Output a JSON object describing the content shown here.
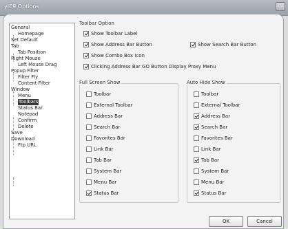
{
  "window": {
    "title": "yIE9 Options"
  },
  "tree": {
    "items": [
      {
        "label": "General"
      },
      {
        "label": "Homepage"
      },
      {
        "label": "Set Default"
      },
      {
        "label": "Tab"
      },
      {
        "label": "Tab Position"
      },
      {
        "label": "Right Mouse"
      },
      {
        "label": "Left Mouse Drag"
      },
      {
        "label": "Popup Filter"
      },
      {
        "label": "Filter Fly"
      },
      {
        "label": "Content Filter"
      },
      {
        "label": "Window"
      },
      {
        "label": "Menu"
      },
      {
        "label": "Toolbars"
      },
      {
        "label": "Status Bar"
      },
      {
        "label": "Notepad"
      },
      {
        "label": "Confirm"
      },
      {
        "label": "Delete"
      },
      {
        "label": "Save"
      },
      {
        "label": "Download"
      },
      {
        "label": "Ftp URL"
      }
    ],
    "selected": "Toolbars"
  },
  "toolbar_option": {
    "title": "Toolbar Option",
    "items": [
      {
        "label": "Show Toolbar Label",
        "checked": true
      },
      {
        "label": "Show Address Bar Button",
        "checked": true
      },
      {
        "label": "Show Search Bar Button",
        "checked": true
      },
      {
        "label": "Show Combo Box Icon",
        "checked": true
      },
      {
        "label": "Clicking Address Bar GO Button Display Proxy Menu",
        "checked": true
      }
    ]
  },
  "full_screen_show": {
    "title": "Full Screen Show",
    "items": [
      {
        "label": "Toolbar",
        "checked": false
      },
      {
        "label": "External Toolbar",
        "checked": false
      },
      {
        "label": "Address Bar",
        "checked": false
      },
      {
        "label": "Search Bar",
        "checked": false
      },
      {
        "label": "Favorites Bar",
        "checked": false
      },
      {
        "label": "Link Bar",
        "checked": false
      },
      {
        "label": "Tab Bar",
        "checked": false
      },
      {
        "label": "System Bar",
        "checked": false
      },
      {
        "label": "Menu Bar",
        "checked": false
      },
      {
        "label": "Status Bar",
        "checked": true
      }
    ]
  },
  "auto_hide_show": {
    "title": "Auto Hide Show",
    "items": [
      {
        "label": "Toolbar",
        "checked": false
      },
      {
        "label": "External Toolbar",
        "checked": false
      },
      {
        "label": "Address Bar",
        "checked": true
      },
      {
        "label": "Search Bar",
        "checked": true
      },
      {
        "label": "Favorites Bar",
        "checked": false
      },
      {
        "label": "Link Bar",
        "checked": false
      },
      {
        "label": "Tab Bar",
        "checked": true
      },
      {
        "label": "System Bar",
        "checked": false
      },
      {
        "label": "Menu Bar",
        "checked": false
      },
      {
        "label": "Status Bar",
        "checked": true
      }
    ]
  },
  "buttons": {
    "ok": "OK",
    "cancel": "Cancel"
  }
}
